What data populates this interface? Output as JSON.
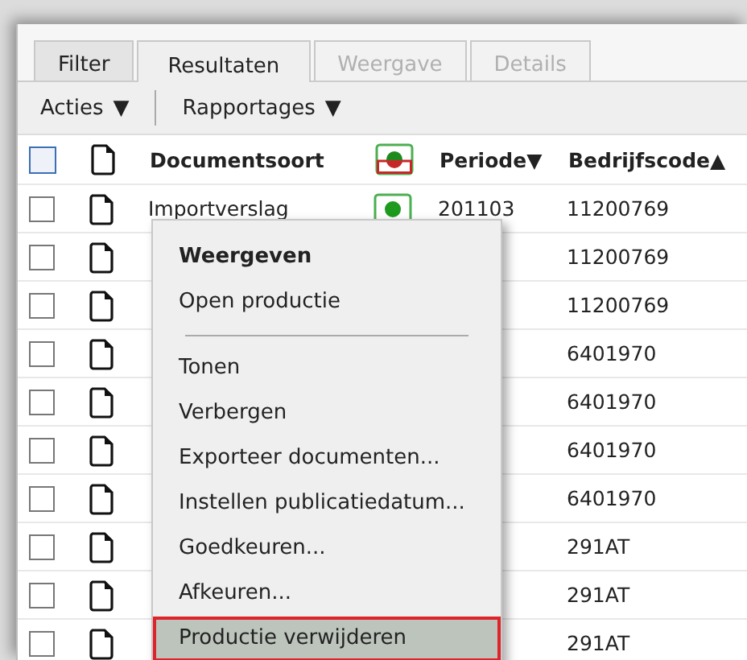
{
  "tabs": [
    {
      "label": "Filter",
      "selected": false,
      "disabled": false
    },
    {
      "label": "Resultaten",
      "selected": true,
      "disabled": false
    },
    {
      "label": "Weergave",
      "selected": false,
      "disabled": true
    },
    {
      "label": "Details",
      "selected": false,
      "disabled": true
    }
  ],
  "toolbar": [
    {
      "label": "Acties",
      "caret": "▼"
    },
    {
      "label": "Rapportages",
      "caret": "▼"
    }
  ],
  "table": {
    "select_all": {
      "checked": false
    },
    "columns": [
      {
        "label": "Documentsoort"
      },
      {
        "label": "Periode",
        "sort": "▼"
      },
      {
        "label": "Bedrijfscode",
        "sort": "▲"
      }
    ],
    "rows": [
      {
        "checked": false,
        "documentsoort": "Importverslag",
        "periode": "201103",
        "bedrijfscode": "11200769"
      },
      {
        "checked": false,
        "bedrijfscode": "11200769"
      },
      {
        "checked": false,
        "bedrijfscode": "11200769"
      },
      {
        "checked": false,
        "bedrijfscode": "6401970"
      },
      {
        "checked": false,
        "bedrijfscode": "6401970"
      },
      {
        "checked": false,
        "bedrijfscode": "6401970"
      },
      {
        "checked": false,
        "bedrijfscode": "6401970"
      },
      {
        "checked": false,
        "bedrijfscode": "291AT"
      },
      {
        "checked": false,
        "bedrijfscode": "291AT"
      },
      {
        "checked": false,
        "bedrijfscode": "291AT"
      }
    ]
  },
  "context_menu": {
    "items": [
      {
        "kind": "default",
        "label": "Weergeven",
        "selected": false
      },
      {
        "kind": "item",
        "label": "Open productie",
        "selected": false
      },
      {
        "kind": "separator"
      },
      {
        "kind": "item",
        "label": "Tonen",
        "selected": false
      },
      {
        "kind": "item",
        "label": "Verbergen",
        "selected": false
      },
      {
        "kind": "item",
        "label": "Exporteer documenten...",
        "selected": false
      },
      {
        "kind": "item",
        "label": "Instellen publicatiedatum...",
        "selected": false
      },
      {
        "kind": "item",
        "label": "Goedkeuren...",
        "selected": false
      },
      {
        "kind": "item",
        "label": "Afkeuren...",
        "selected": false
      },
      {
        "kind": "item",
        "label": "Productie verwijderen",
        "selected": true
      }
    ]
  }
}
